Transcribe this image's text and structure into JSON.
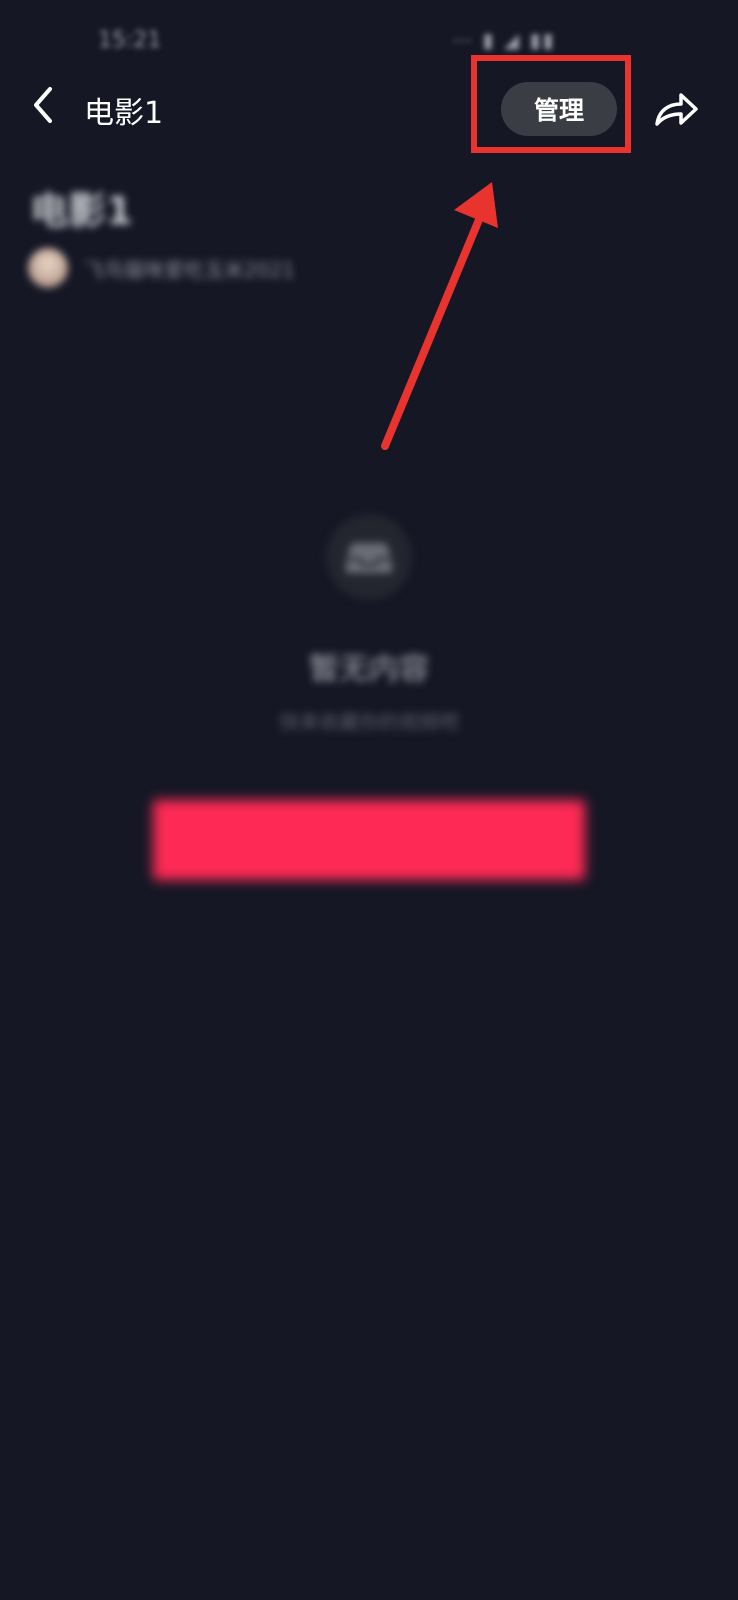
{
  "status_bar": {
    "time": "15:21",
    "icons": "⋯ ▮ ◢ ▮▮"
  },
  "header": {
    "title": "电影1",
    "manage_label": "管理"
  },
  "playlist": {
    "title": "电影1",
    "owner_name": "飞鸟猫咪爱吃玉米2021"
  },
  "empty_state": {
    "title": "暂无内容",
    "subtitle": "快来收藏你的视频吧",
    "button_label": ""
  },
  "colors": {
    "background": "#151725",
    "manage_button": "#3b3d45",
    "primary_button": "#fe2a55",
    "annotation": "#e8332e"
  },
  "icons": {
    "back": "chevron-left-icon",
    "share": "share-arrow-icon",
    "empty": "inbox-icon"
  }
}
